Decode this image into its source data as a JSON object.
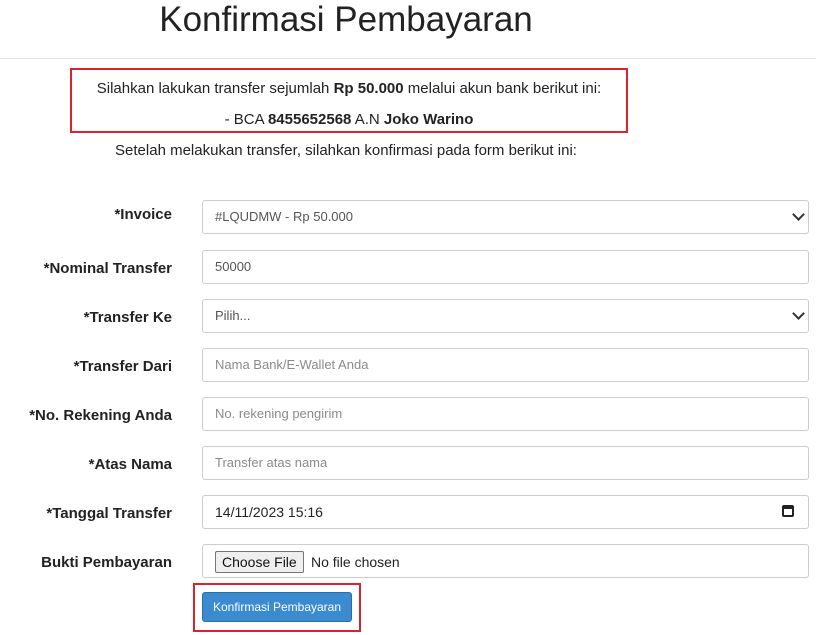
{
  "page": {
    "title": "Konfirmasi Pembayaran"
  },
  "notice": {
    "line1_prefix": "Silahkan lakukan transfer sejumlah ",
    "amount": "Rp 50.000",
    "line1_suffix": " melalui akun bank berikut ini:",
    "line2_prefix": "- BCA ",
    "account_number": "8455652568",
    "line2_mid": " A.N ",
    "account_name": "Joko Warino"
  },
  "instruction": "Setelah melakukan transfer, silahkan konfirmasi pada form berikut ini:",
  "form": {
    "invoice": {
      "label": "*Invoice",
      "value": "#LQUDMW - Rp 50.000"
    },
    "nominal": {
      "label": "*Nominal Transfer",
      "value": "50000"
    },
    "transfer_ke": {
      "label": "*Transfer Ke",
      "value": "Pilih..."
    },
    "transfer_dari": {
      "label": "*Transfer Dari",
      "placeholder": "Nama Bank/E-Wallet Anda"
    },
    "rekening": {
      "label": "*No. Rekening Anda",
      "placeholder": "No. rekening pengirim"
    },
    "atas_nama": {
      "label": "*Atas Nama",
      "placeholder": "Transfer atas nama"
    },
    "tanggal": {
      "label": "*Tanggal Transfer",
      "value": "14/11/2023 15:16"
    },
    "bukti": {
      "label": "Bukti Pembayaran",
      "button_label": "Choose File",
      "status": "No file chosen"
    }
  },
  "submit": {
    "label": "Konfirmasi Pembayaran"
  },
  "colors": {
    "highlight_border": "#d9232e",
    "primary_button": "#3b8bd0"
  }
}
